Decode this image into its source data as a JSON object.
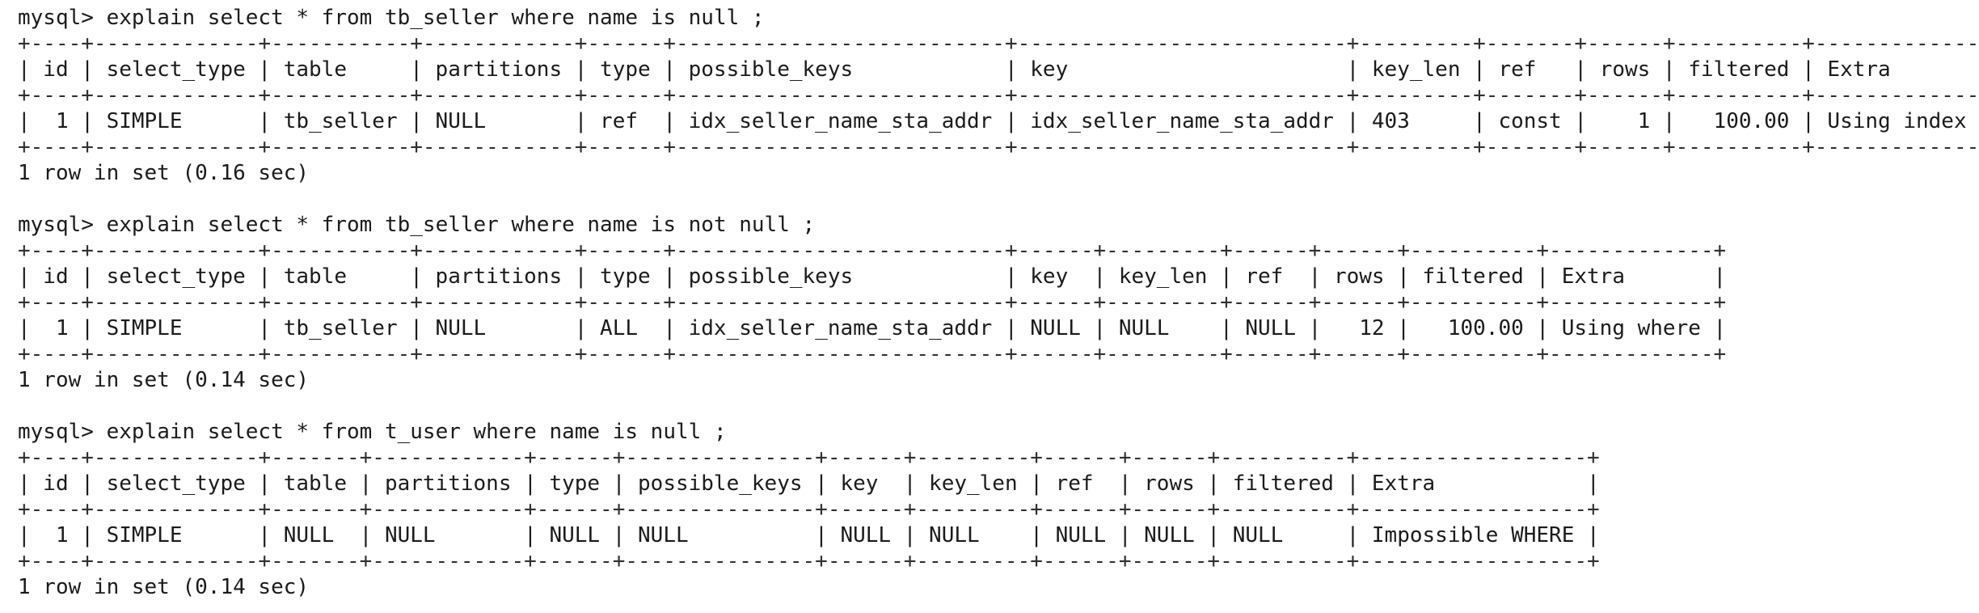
{
  "terminal": {
    "prompt": "mysql>",
    "blocks": [
      {
        "command": "explain select * from tb_seller where name is null ;",
        "separator": "+----+-------------+-----------+------------+------+--------------------------+--------------------------+---------+-------+------+----------+-------------------------------------",
        "header": "| id | select_type | table     | partitions | type | possible_keys            | key                      | key_len | ref   | rows | filtered | Extra",
        "rows": [
          "|  1 | SIMPLE      | tb_seller | NULL       | ref  | idx_seller_name_sta_addr | idx_seller_name_sta_addr | 403     | const |    1 |   100.00 | Using index conditi"
        ],
        "result": "1 row in set (0.16 sec)"
      },
      {
        "command": "explain select * from tb_seller where name is not null ;",
        "separator": "+----+-------------+-----------+------------+------+--------------------------+------+---------+------+------+----------+-------------+",
        "header": "| id | select_type | table     | partitions | type | possible_keys            | key  | key_len | ref  | rows | filtered | Extra       |",
        "rows": [
          "|  1 | SIMPLE      | tb_seller | NULL       | ALL  | idx_seller_name_sta_addr | NULL | NULL    | NULL |   12 |   100.00 | Using where |"
        ],
        "result": "1 row in set (0.14 sec)"
      },
      {
        "command": "explain select * from t_user where name is null ;",
        "separator": "+----+-------------+-------+------------+------+---------------+------+---------+------+------+----------+------------------+",
        "header": "| id | select_type | table | partitions | type | possible_keys | key  | key_len | ref  | rows | filtered | Extra            |",
        "rows": [
          "|  1 | SIMPLE      | NULL  | NULL       | NULL | NULL          | NULL | NULL    | NULL | NULL | NULL     | Impossible WHERE |"
        ],
        "result": "1 row in set (0.14 sec)"
      }
    ]
  }
}
